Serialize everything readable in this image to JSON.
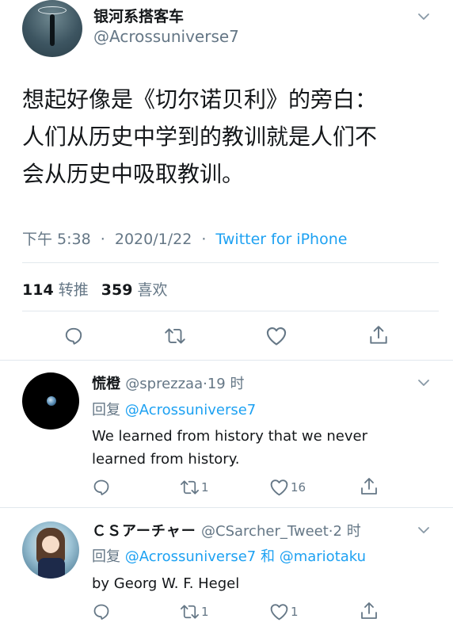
{
  "main_tweet": {
    "display_name": "银河系搭客车",
    "handle": "@Acrossuniverse7",
    "text_lines": [
      "想起好像是《切尔诺贝利》的旁白：",
      "人们从历史中学到的教训就是人们不",
      "会从历史中吸取教训。"
    ],
    "time": "下午 5:38",
    "date": "2020/1/22",
    "separator": "·",
    "source": "Twitter for iPhone",
    "retweet_count": "114",
    "retweet_label": "转推",
    "like_count": "359",
    "like_label": "喜欢"
  },
  "replies": [
    {
      "display_name": "慌橙",
      "handle": "@sprezzaa",
      "separator": "·",
      "time": "19 时",
      "reply_prefix": "回复",
      "mentions": [
        "@Acrossuniverse7"
      ],
      "text_lines": [
        "We learned from history that we never",
        "learned from history."
      ],
      "retweet_count": "1",
      "like_count": "16"
    },
    {
      "display_name": "ＣＳアーチャー",
      "handle": "@CSarcher_Tweet",
      "separator": "·",
      "time": "2 时",
      "reply_prefix": "回复",
      "mentions": [
        "@Acrossuniverse7",
        "@mariotaku"
      ],
      "mention_joiner": "和",
      "text_lines": [
        "by Georg W. F. Hegel"
      ],
      "retweet_count": "1",
      "like_count": "1"
    }
  ],
  "colors": {
    "accent": "#1da1f2",
    "secondary_text": "#657786",
    "primary_text": "#14171a",
    "divider": "#e1e8ed"
  },
  "icons": [
    "reply-icon",
    "retweet-icon",
    "like-icon",
    "share-icon",
    "chevron-down-icon"
  ]
}
